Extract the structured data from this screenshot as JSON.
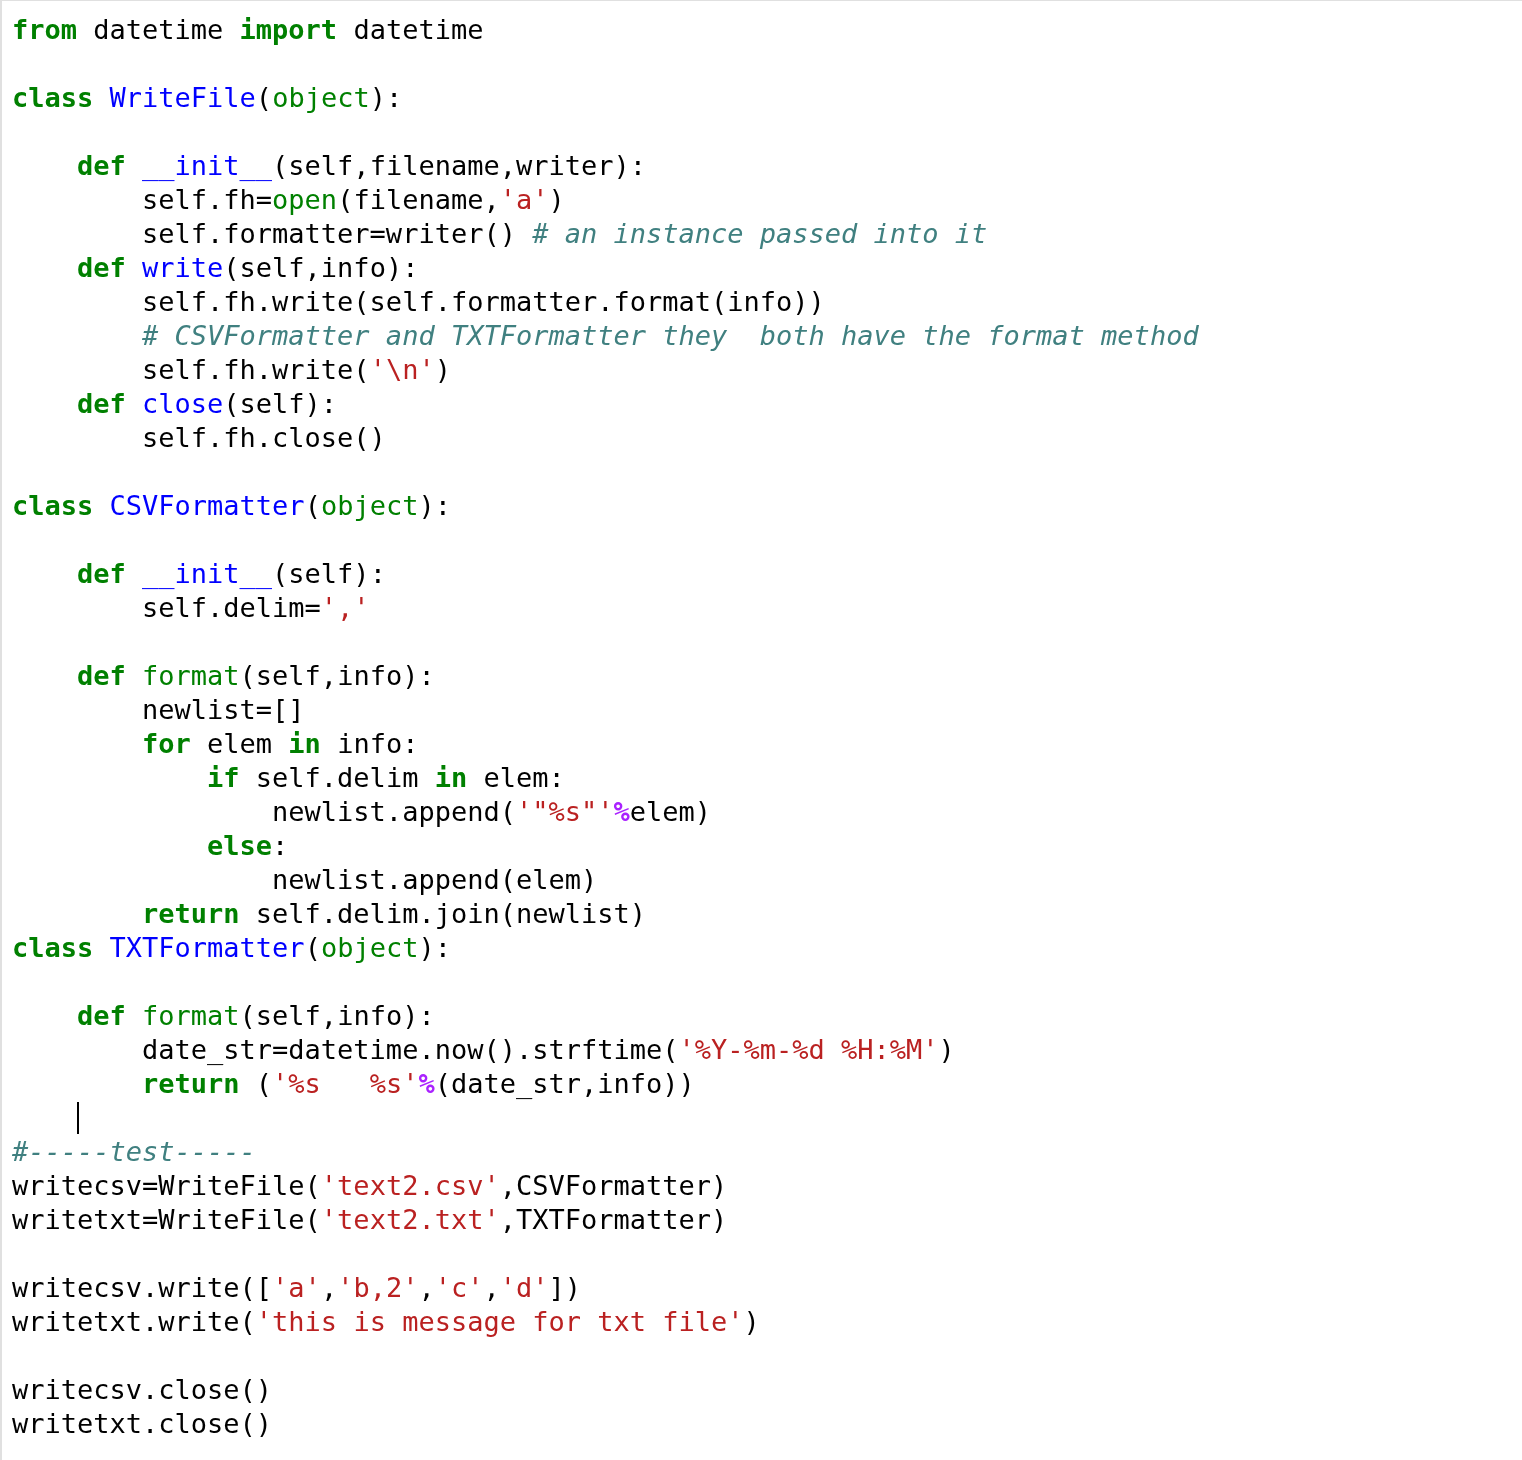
{
  "code_cell": {
    "lines": [
      {
        "cursor": false,
        "tokens": [
          {
            "text": "from",
            "kind": "keyword"
          },
          {
            "text": " datetime ",
            "kind": "plain"
          },
          {
            "text": "import",
            "kind": "keyword"
          },
          {
            "text": " datetime",
            "kind": "plain"
          }
        ]
      },
      {
        "cursor": false
      },
      {
        "cursor": false,
        "tokens": [
          {
            "text": "class ",
            "kind": "keyword"
          },
          {
            "text": "WriteFile",
            "kind": "name"
          },
          {
            "text": "(",
            "kind": "plain"
          },
          {
            "text": "object",
            "kind": "builtin"
          },
          {
            "text": "):",
            "kind": "plain"
          }
        ]
      },
      {
        "cursor": false
      },
      {
        "cursor": false,
        "tokens": [
          {
            "text": "    def ",
            "kind": "keyword"
          },
          {
            "text": "__init__",
            "kind": "name"
          },
          {
            "text": "(self,filename,writer):",
            "kind": "plain"
          }
        ]
      },
      {
        "cursor": false,
        "tokens": [
          {
            "text": "        self.fh=",
            "kind": "plain"
          },
          {
            "text": "open",
            "kind": "builtin"
          },
          {
            "text": "(filename,",
            "kind": "plain"
          },
          {
            "text": "'a'",
            "kind": "string"
          },
          {
            "text": ")",
            "kind": "plain"
          }
        ]
      },
      {
        "cursor": false,
        "tokens": [
          {
            "text": "        self.formatter=writer() ",
            "kind": "plain"
          },
          {
            "text": "# an instance passed into it",
            "kind": "comment"
          }
        ]
      },
      {
        "cursor": false,
        "tokens": [
          {
            "text": "    def ",
            "kind": "keyword"
          },
          {
            "text": "write",
            "kind": "name"
          },
          {
            "text": "(self,info):",
            "kind": "plain"
          }
        ]
      },
      {
        "cursor": false,
        "tokens": [
          {
            "text": "        self.fh.write(self.formatter.format(info))",
            "kind": "plain"
          }
        ]
      },
      {
        "cursor": false,
        "tokens": [
          {
            "text": "        # CSVFormatter and TXTFormatter they  both have the format method",
            "kind": "comment"
          }
        ]
      },
      {
        "cursor": false,
        "tokens": [
          {
            "text": "        self.fh.write(",
            "kind": "plain"
          },
          {
            "text": "'\\n'",
            "kind": "string"
          },
          {
            "text": ")",
            "kind": "plain"
          }
        ]
      },
      {
        "cursor": false,
        "tokens": [
          {
            "text": "    def ",
            "kind": "keyword"
          },
          {
            "text": "close",
            "kind": "name"
          },
          {
            "text": "(self):",
            "kind": "plain"
          }
        ]
      },
      {
        "cursor": false,
        "tokens": [
          {
            "text": "        self.fh.close()",
            "kind": "plain"
          }
        ]
      },
      {
        "cursor": false
      },
      {
        "cursor": false,
        "tokens": [
          {
            "text": "class ",
            "kind": "keyword"
          },
          {
            "text": "CSVFormatter",
            "kind": "name"
          },
          {
            "text": "(",
            "kind": "plain"
          },
          {
            "text": "object",
            "kind": "builtin"
          },
          {
            "text": "):",
            "kind": "plain"
          }
        ]
      },
      {
        "cursor": false
      },
      {
        "cursor": false,
        "tokens": [
          {
            "text": "    def ",
            "kind": "keyword"
          },
          {
            "text": "__init__",
            "kind": "name"
          },
          {
            "text": "(self):",
            "kind": "plain"
          }
        ]
      },
      {
        "cursor": false,
        "tokens": [
          {
            "text": "        self.delim=",
            "kind": "plain"
          },
          {
            "text": "','",
            "kind": "string"
          }
        ]
      },
      {
        "cursor": false
      },
      {
        "cursor": false,
        "tokens": [
          {
            "text": "    def ",
            "kind": "keyword"
          },
          {
            "text": "format",
            "kind": "builtin"
          },
          {
            "text": "(self,info):",
            "kind": "plain"
          }
        ]
      },
      {
        "cursor": false,
        "tokens": [
          {
            "text": "        newlist=[]",
            "kind": "plain"
          }
        ]
      },
      {
        "cursor": false,
        "tokens": [
          {
            "text": "        for",
            "kind": "keyword"
          },
          {
            "text": " elem ",
            "kind": "plain"
          },
          {
            "text": "in",
            "kind": "keyword"
          },
          {
            "text": " info:",
            "kind": "plain"
          }
        ]
      },
      {
        "cursor": false,
        "tokens": [
          {
            "text": "            if",
            "kind": "keyword"
          },
          {
            "text": " self.delim ",
            "kind": "plain"
          },
          {
            "text": "in",
            "kind": "keyword"
          },
          {
            "text": " elem:",
            "kind": "plain"
          }
        ]
      },
      {
        "cursor": false,
        "tokens": [
          {
            "text": "                newlist.append(",
            "kind": "plain"
          },
          {
            "text": "'\"%s\"'",
            "kind": "string"
          },
          {
            "text": "%",
            "kind": "operator"
          },
          {
            "text": "elem)",
            "kind": "plain"
          }
        ]
      },
      {
        "cursor": false,
        "tokens": [
          {
            "text": "            else",
            "kind": "keyword"
          },
          {
            "text": ":",
            "kind": "plain"
          }
        ]
      },
      {
        "cursor": false,
        "tokens": [
          {
            "text": "                newlist.append(elem)",
            "kind": "plain"
          }
        ]
      },
      {
        "cursor": false,
        "tokens": [
          {
            "text": "        return",
            "kind": "keyword"
          },
          {
            "text": " self.delim.join(newlist)",
            "kind": "plain"
          }
        ]
      },
      {
        "cursor": false,
        "tokens": [
          {
            "text": "class ",
            "kind": "keyword"
          },
          {
            "text": "TXTFormatter",
            "kind": "name"
          },
          {
            "text": "(",
            "kind": "plain"
          },
          {
            "text": "object",
            "kind": "builtin"
          },
          {
            "text": "):",
            "kind": "plain"
          }
        ]
      },
      {
        "cursor": false
      },
      {
        "cursor": false,
        "tokens": [
          {
            "text": "    def ",
            "kind": "keyword"
          },
          {
            "text": "format",
            "kind": "builtin"
          },
          {
            "text": "(self,info):",
            "kind": "plain"
          }
        ]
      },
      {
        "cursor": false,
        "tokens": [
          {
            "text": "        date_str=datetime.now().strftime(",
            "kind": "plain"
          },
          {
            "text": "'%Y-%m-%d %H:%M'",
            "kind": "string"
          },
          {
            "text": ")",
            "kind": "plain"
          }
        ]
      },
      {
        "cursor": false,
        "tokens": [
          {
            "text": "        return",
            "kind": "keyword"
          },
          {
            "text": " (",
            "kind": "plain"
          },
          {
            "text": "'%s   %s'",
            "kind": "string"
          },
          {
            "text": "%",
            "kind": "operator"
          },
          {
            "text": "(date_str,info))",
            "kind": "plain"
          }
        ]
      },
      {
        "cursor": true
      },
      {
        "cursor": false,
        "tokens": [
          {
            "text": "#-----test-----",
            "kind": "comment"
          }
        ]
      },
      {
        "cursor": false,
        "tokens": [
          {
            "text": "writecsv=WriteFile(",
            "kind": "plain"
          },
          {
            "text": "'text2.csv'",
            "kind": "string"
          },
          {
            "text": ",CSVFormatter)",
            "kind": "plain"
          }
        ]
      },
      {
        "cursor": false,
        "tokens": [
          {
            "text": "writetxt=WriteFile(",
            "kind": "plain"
          },
          {
            "text": "'text2.txt'",
            "kind": "string"
          },
          {
            "text": ",TXTFormatter)",
            "kind": "plain"
          }
        ]
      },
      {
        "cursor": false
      },
      {
        "cursor": false,
        "tokens": [
          {
            "text": "writecsv.write([",
            "kind": "plain"
          },
          {
            "text": "'a'",
            "kind": "string"
          },
          {
            "text": ",",
            "kind": "plain"
          },
          {
            "text": "'b,2'",
            "kind": "string"
          },
          {
            "text": ",",
            "kind": "plain"
          },
          {
            "text": "'c'",
            "kind": "string"
          },
          {
            "text": ",",
            "kind": "plain"
          },
          {
            "text": "'d'",
            "kind": "string"
          },
          {
            "text": "])",
            "kind": "plain"
          }
        ]
      },
      {
        "cursor": false,
        "tokens": [
          {
            "text": "writetxt.write(",
            "kind": "plain"
          },
          {
            "text": "'this is message for txt file'",
            "kind": "string"
          },
          {
            "text": ")",
            "kind": "plain"
          }
        ]
      },
      {
        "cursor": false
      },
      {
        "cursor": false,
        "tokens": [
          {
            "text": "writecsv.close()",
            "kind": "plain"
          }
        ]
      },
      {
        "cursor": false,
        "tokens": [
          {
            "text": "writetxt.close()",
            "kind": "plain"
          }
        ]
      }
    ]
  }
}
